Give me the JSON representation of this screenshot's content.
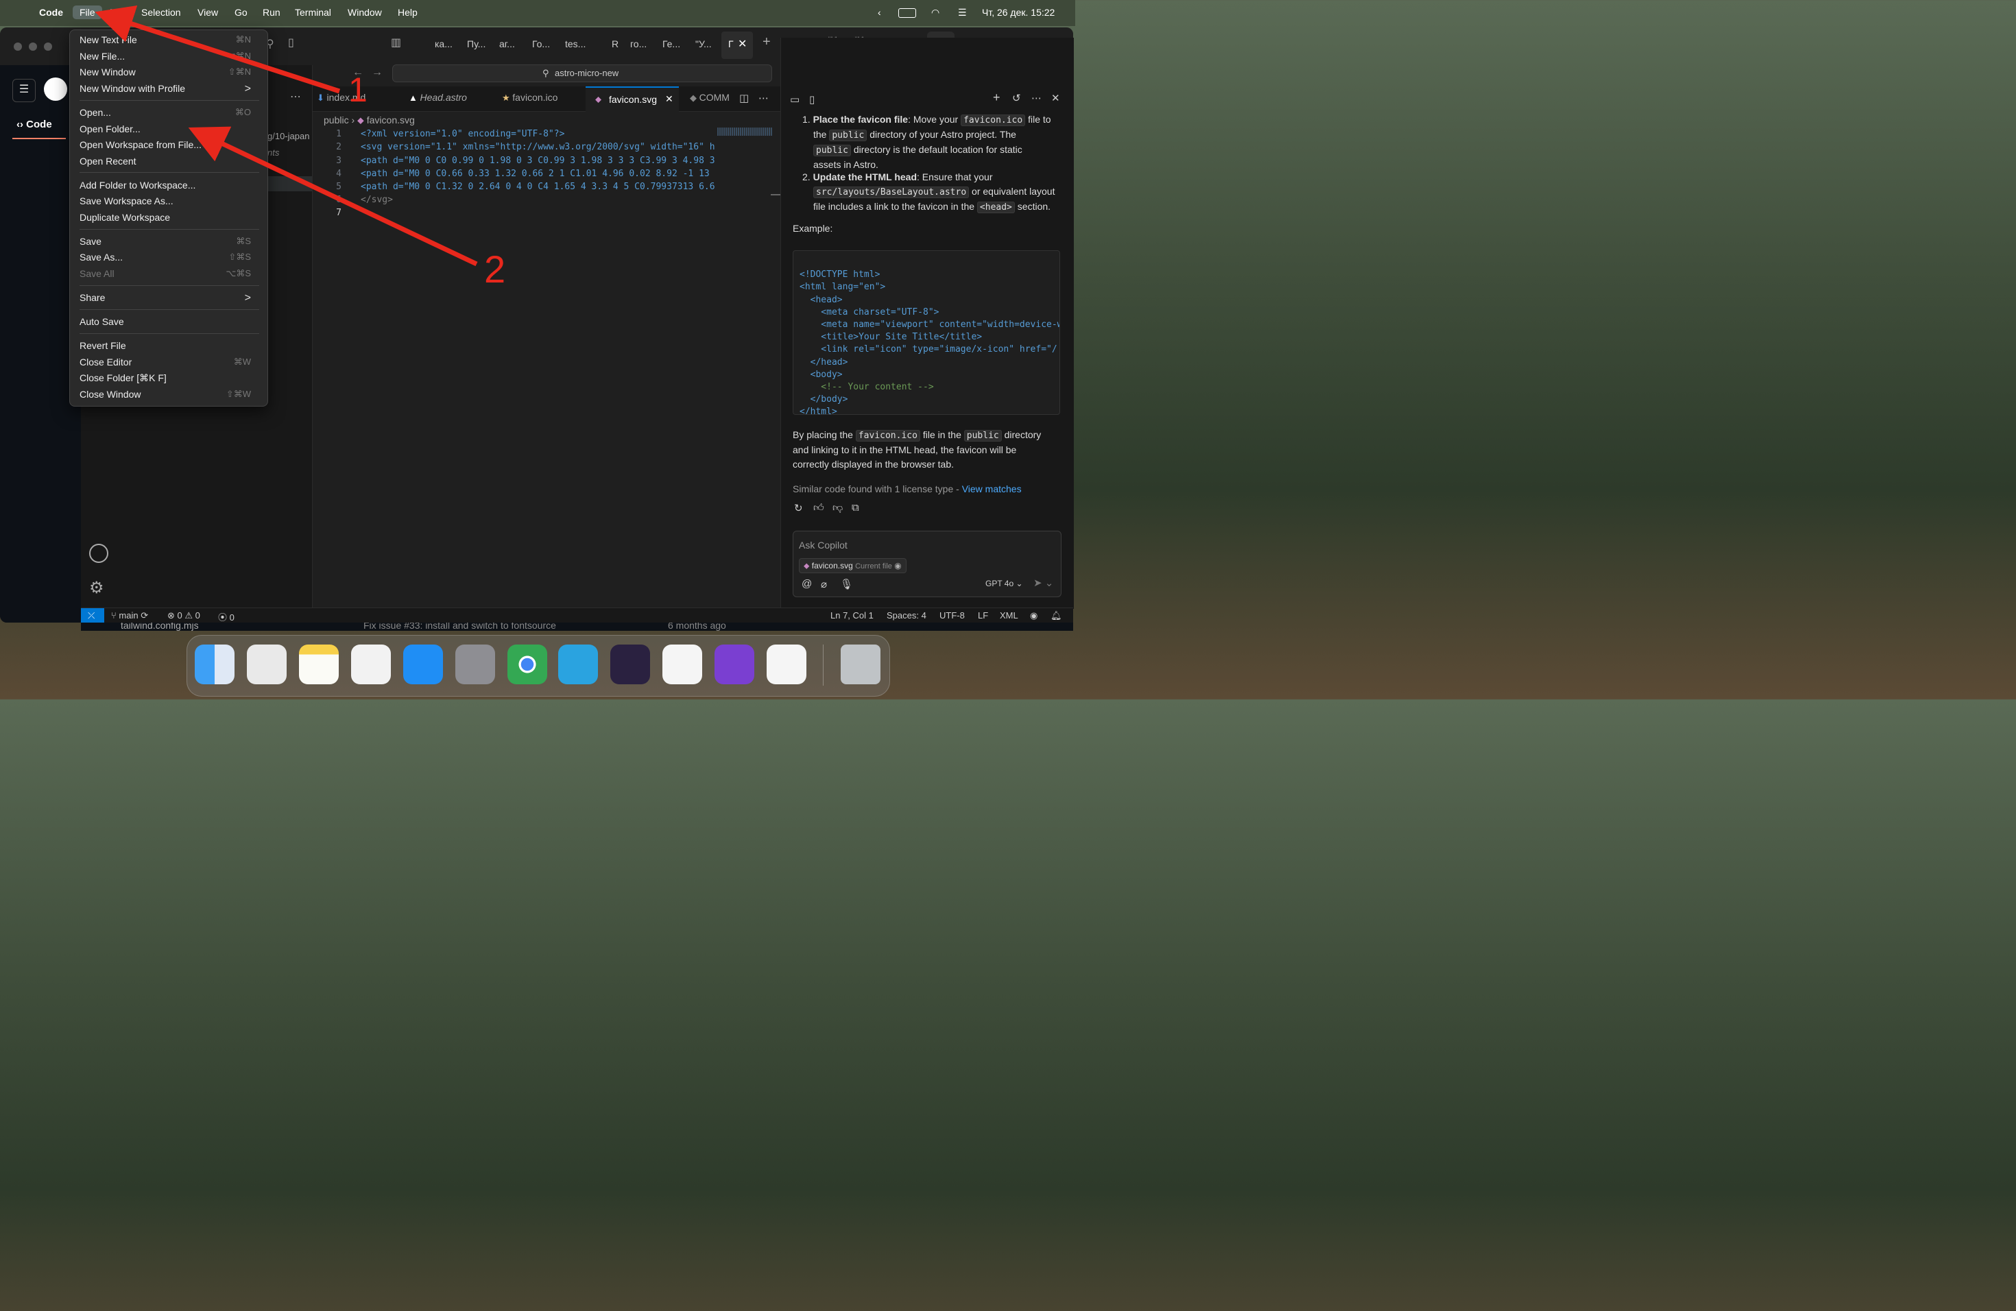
{
  "menubar": {
    "app": "Code",
    "items": [
      "File",
      "Edit",
      "Selection",
      "View",
      "Go",
      "Run",
      "Terminal",
      "Window",
      "Help"
    ],
    "datetime": "Чт, 26 дек.  15:22"
  },
  "tabs_top": [
    "ка...",
    "Пу...",
    "аг...",
    "Го...",
    "tes...",
    "R",
    "го...",
    "Ге...",
    "\"У...",
    "Г"
  ],
  "search": "astro-micro-new",
  "github": {
    "code_tab": "Code"
  },
  "explorer": {
    "items": [
      "g/10-japan",
      "nts"
    ]
  },
  "editor_tabs": [
    {
      "label": "index.md",
      "active": false
    },
    {
      "label": "Head.astro",
      "active": false
    },
    {
      "label": "favicon.ico",
      "active": false
    },
    {
      "label": "favicon.svg",
      "active": true
    },
    {
      "label": "COMM",
      "active": false
    }
  ],
  "breadcrumb": [
    "public",
    "favicon.svg"
  ],
  "code": [
    "<?xml version=\"1.0\" encoding=\"UTF-8\"?>",
    "<svg version=\"1.1\" xmlns=\"http://www.w3.org/2000/svg\" width=\"16\" he",
    "<path d=\"M0 0 C0 0.99 0 1.98 0 3 C0.99 3 1.98 3 3 3 C3.99 3 4.98 3 ",
    "<path d=\"M0 0 C0.66 0.33 1.32 0.66 2 1 C1.01 4.96 0.02 8.92 -1 13 C",
    "<path d=\"M0 0 C1.32 0 2.64 0 4 0 C4 1.65 4 3.3 4 5 C0.79937313 6.60",
    "</svg>",
    ""
  ],
  "file_menu": {
    "groups": [
      [
        {
          "label": "New Text File",
          "shortcut": "⌘N"
        },
        {
          "label": "New File...",
          "shortcut": "⌃⌥⌘N"
        },
        {
          "label": "New Window",
          "shortcut": "⇧⌘N"
        },
        {
          "label": "New Window with Profile",
          "shortcut": ">"
        }
      ],
      [
        {
          "label": "Open...",
          "shortcut": "⌘O"
        },
        {
          "label": "Open Folder...",
          "shortcut": ""
        },
        {
          "label": "Open Workspace from File...",
          "shortcut": ""
        },
        {
          "label": "Open Recent",
          "shortcut": ""
        }
      ],
      [
        {
          "label": "Add Folder to Workspace...",
          "shortcut": ""
        },
        {
          "label": "Save Workspace As...",
          "shortcut": ""
        },
        {
          "label": "Duplicate Workspace",
          "shortcut": ""
        }
      ],
      [
        {
          "label": "Save",
          "shortcut": "⌘S"
        },
        {
          "label": "Save As...",
          "shortcut": "⇧⌘S"
        },
        {
          "label": "Save All",
          "shortcut": "⌥⌘S",
          "disabled": true
        }
      ],
      [
        {
          "label": "Share",
          "shortcut": ">"
        }
      ],
      [
        {
          "label": "Auto Save",
          "shortcut": ""
        }
      ],
      [
        {
          "label": "Revert File",
          "shortcut": ""
        },
        {
          "label": "Close Editor",
          "shortcut": "⌘W"
        },
        {
          "label": "Close Folder [⌘K F]",
          "shortcut": ""
        },
        {
          "label": "Close Window",
          "shortcut": "⇧⌘W"
        }
      ]
    ]
  },
  "annotations": {
    "one": "1",
    "two": "2",
    "color": "#e8281c"
  },
  "chat": {
    "step1_bold": "Place the favicon file",
    "step1_a": ": Move your ",
    "step1_code1": "favicon.ico",
    "step1_b": " file to",
    "step1_c": "the ",
    "step1_code2": "public",
    "step1_d": " directory of your Astro project. The",
    "step1_code3": "public",
    "step1_e": " directory is the default location for static",
    "step1_f": "assets in Astro.",
    "step2_bold": "Update the HTML head",
    "step2_a": ": Ensure that your",
    "step2_code1": "src/layouts/BaseLayout.astro",
    "step2_b": " or equivalent layout",
    "step2_c": "file includes a link to the favicon in the ",
    "step2_code2": "<head>",
    "step2_d": " section.",
    "example": "Example:",
    "code_block": [
      "<!DOCTYPE html>",
      "<html lang=\"en\">",
      "  <head>",
      "    <meta charset=\"UTF-8\">",
      "    <meta name=\"viewport\" content=\"width=device-w",
      "    <title>Your Site Title</title>",
      "    <link rel=\"icon\" type=\"image/x-icon\" href=\"/",
      "  </head>",
      "  <body>",
      "    <!-- Your content -->",
      "  </body>",
      "</html>"
    ],
    "para1": "By placing the ",
    "para_code1": "favicon.ico",
    "para2": " file in the ",
    "para_code2": "public",
    "para3": " directory",
    "para4": "and linking to it in the HTML head, the favicon will be",
    "para5": "correctly displayed in the browser tab.",
    "license": "Similar code found with 1 license type - ",
    "view_matches": "View matches",
    "ask_placeholder": "Ask Copilot",
    "context_file": "favicon.svg",
    "context_label": "Current file",
    "model": "GPT 4o"
  },
  "status": {
    "branch": "main",
    "errors": "0",
    "warnings": "0",
    "ports": "0",
    "position": "Ln 7, Col 1",
    "spaces": "Spaces: 4",
    "encoding": "UTF-8",
    "eol": "LF",
    "lang": "XML"
  },
  "background_row": {
    "file": "tailwind.config.mjs",
    "commit": "Fix issue #33: install and switch to fontsource",
    "time": "6 months ago"
  }
}
